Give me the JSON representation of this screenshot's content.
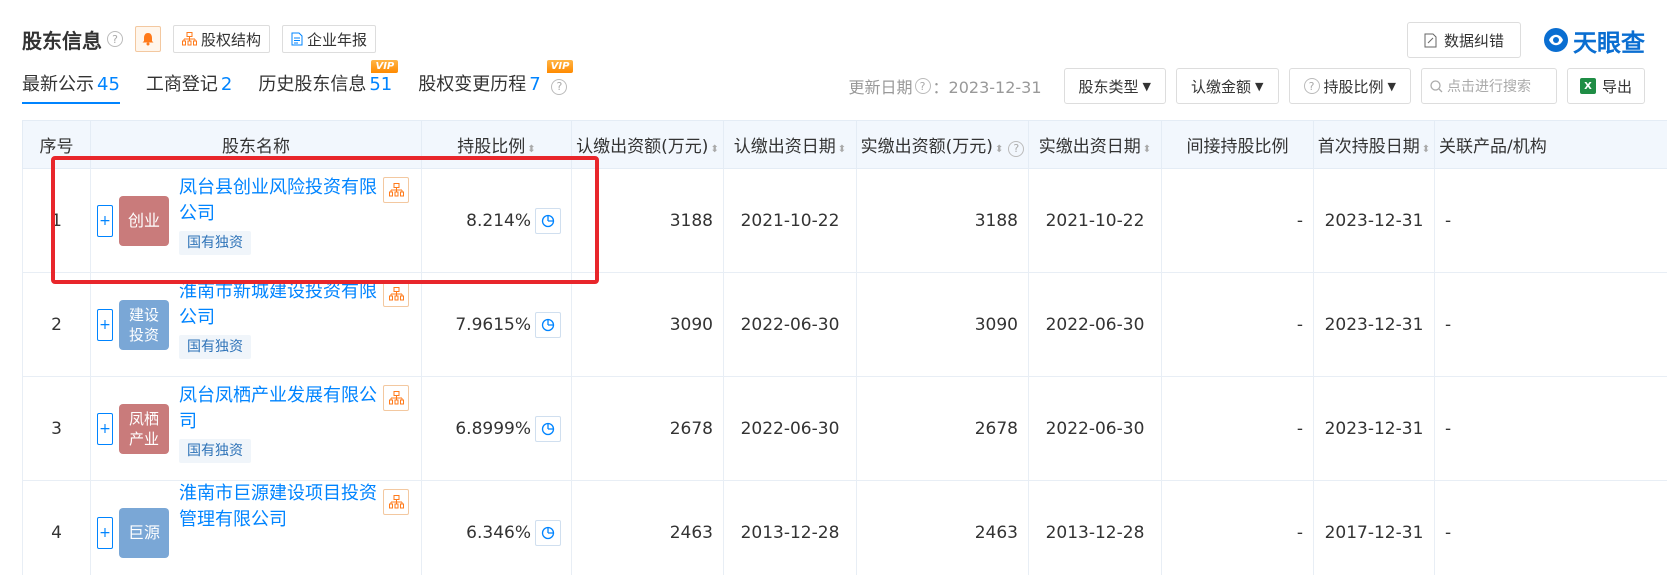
{
  "header": {
    "title": "股东信息",
    "btn_structure": "股权结构",
    "btn_annual": "企业年报",
    "btn_correct": "数据纠错",
    "logo_text": "天眼查"
  },
  "tabs": [
    {
      "label": "最新公示",
      "count": "45"
    },
    {
      "label": "工商登记",
      "count": "2"
    },
    {
      "label": "历史股东信息",
      "count": "51",
      "vip": "VIP"
    },
    {
      "label": "股权变更历程",
      "count": "7",
      "vip": "VIP"
    }
  ],
  "filters": {
    "update_label": "更新日期",
    "update_value": "：2023-12-31",
    "type": "股东类型",
    "amount": "认缴金额",
    "ratio": "持股比例",
    "search_placeholder": "点击进行搜索",
    "export": "导出"
  },
  "table": {
    "headers": [
      "序号",
      "股东名称",
      "持股比例",
      "认缴出资额(万元)",
      "认缴出资日期",
      "实缴出资额(万元)",
      "实缴出资日期",
      "间接持股比例",
      "首次持股日期",
      "关联产品/机构"
    ],
    "rows": [
      {
        "idx": "1",
        "logo": "创业",
        "logo_color": "#c97b7b",
        "name": "凤台县创业风险投资有限公司",
        "tag": "国有独资",
        "ratio": "8.214%",
        "sub_amount": "3188",
        "sub_date": "2021-10-22",
        "paid_amount": "3188",
        "paid_date": "2021-10-22",
        "indirect": "-",
        "first_date": "2023-12-31",
        "related": "-"
      },
      {
        "idx": "2",
        "logo": "建设投资",
        "logo_color": "#7aa7d6",
        "name": "淮南市新城建设投资有限公司",
        "tag": "国有独资",
        "ratio": "7.9615%",
        "sub_amount": "3090",
        "sub_date": "2022-06-30",
        "paid_amount": "3090",
        "paid_date": "2022-06-30",
        "indirect": "-",
        "first_date": "2023-12-31",
        "related": "-"
      },
      {
        "idx": "3",
        "logo": "凤栖产业",
        "logo_color": "#c97b7b",
        "name": "凤台凤栖产业发展有限公司",
        "tag": "国有独资",
        "ratio": "6.8999%",
        "sub_amount": "2678",
        "sub_date": "2022-06-30",
        "paid_amount": "2678",
        "paid_date": "2022-06-30",
        "indirect": "-",
        "first_date": "2023-12-31",
        "related": "-"
      },
      {
        "idx": "4",
        "logo": "巨源",
        "logo_color": "#7aa7d6",
        "name": "淮南市巨源建设项目投资管理有限公司",
        "tag": "",
        "ratio": "6.346%",
        "sub_amount": "2463",
        "sub_date": "2013-12-28",
        "paid_amount": "2463",
        "paid_date": "2013-12-28",
        "indirect": "-",
        "first_date": "2017-12-31",
        "related": "-"
      }
    ]
  },
  "colors": {
    "accent": "#0084ff",
    "highlight": "#e8262b",
    "header_bg": "#f2f7fd"
  }
}
